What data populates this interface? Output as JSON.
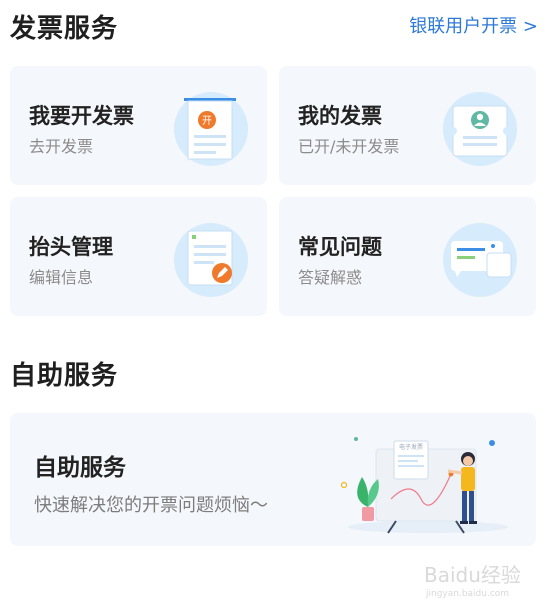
{
  "invoice_section": {
    "title": "发票服务",
    "link": "银联用户开票 >"
  },
  "cards": [
    {
      "title": "我要开发票",
      "subtitle": "去开发票",
      "icon": "invoice-issue-icon",
      "badge": "开"
    },
    {
      "title": "我的发票",
      "subtitle": "已开/未开发票",
      "icon": "my-invoice-icon"
    },
    {
      "title": "抬头管理",
      "subtitle": "编辑信息",
      "icon": "title-edit-icon"
    },
    {
      "title": "常见问题",
      "subtitle": "答疑解惑",
      "icon": "faq-chat-icon"
    }
  ],
  "self_section": {
    "title": "自助服务",
    "card_title": "自助服务",
    "card_subtitle": "快速解决您的开票问题烦恼～",
    "illustration": "self-service-illustration",
    "board_label": "电子发票"
  },
  "watermark": {
    "text": "Baidu经验",
    "subtext": "jingyan.baidu.com"
  },
  "colors": {
    "accent": "#2d7ad6",
    "card_bg": "#f4f7fb",
    "icon_circle": "#d6ebfb",
    "badge": "#f07a2b"
  }
}
